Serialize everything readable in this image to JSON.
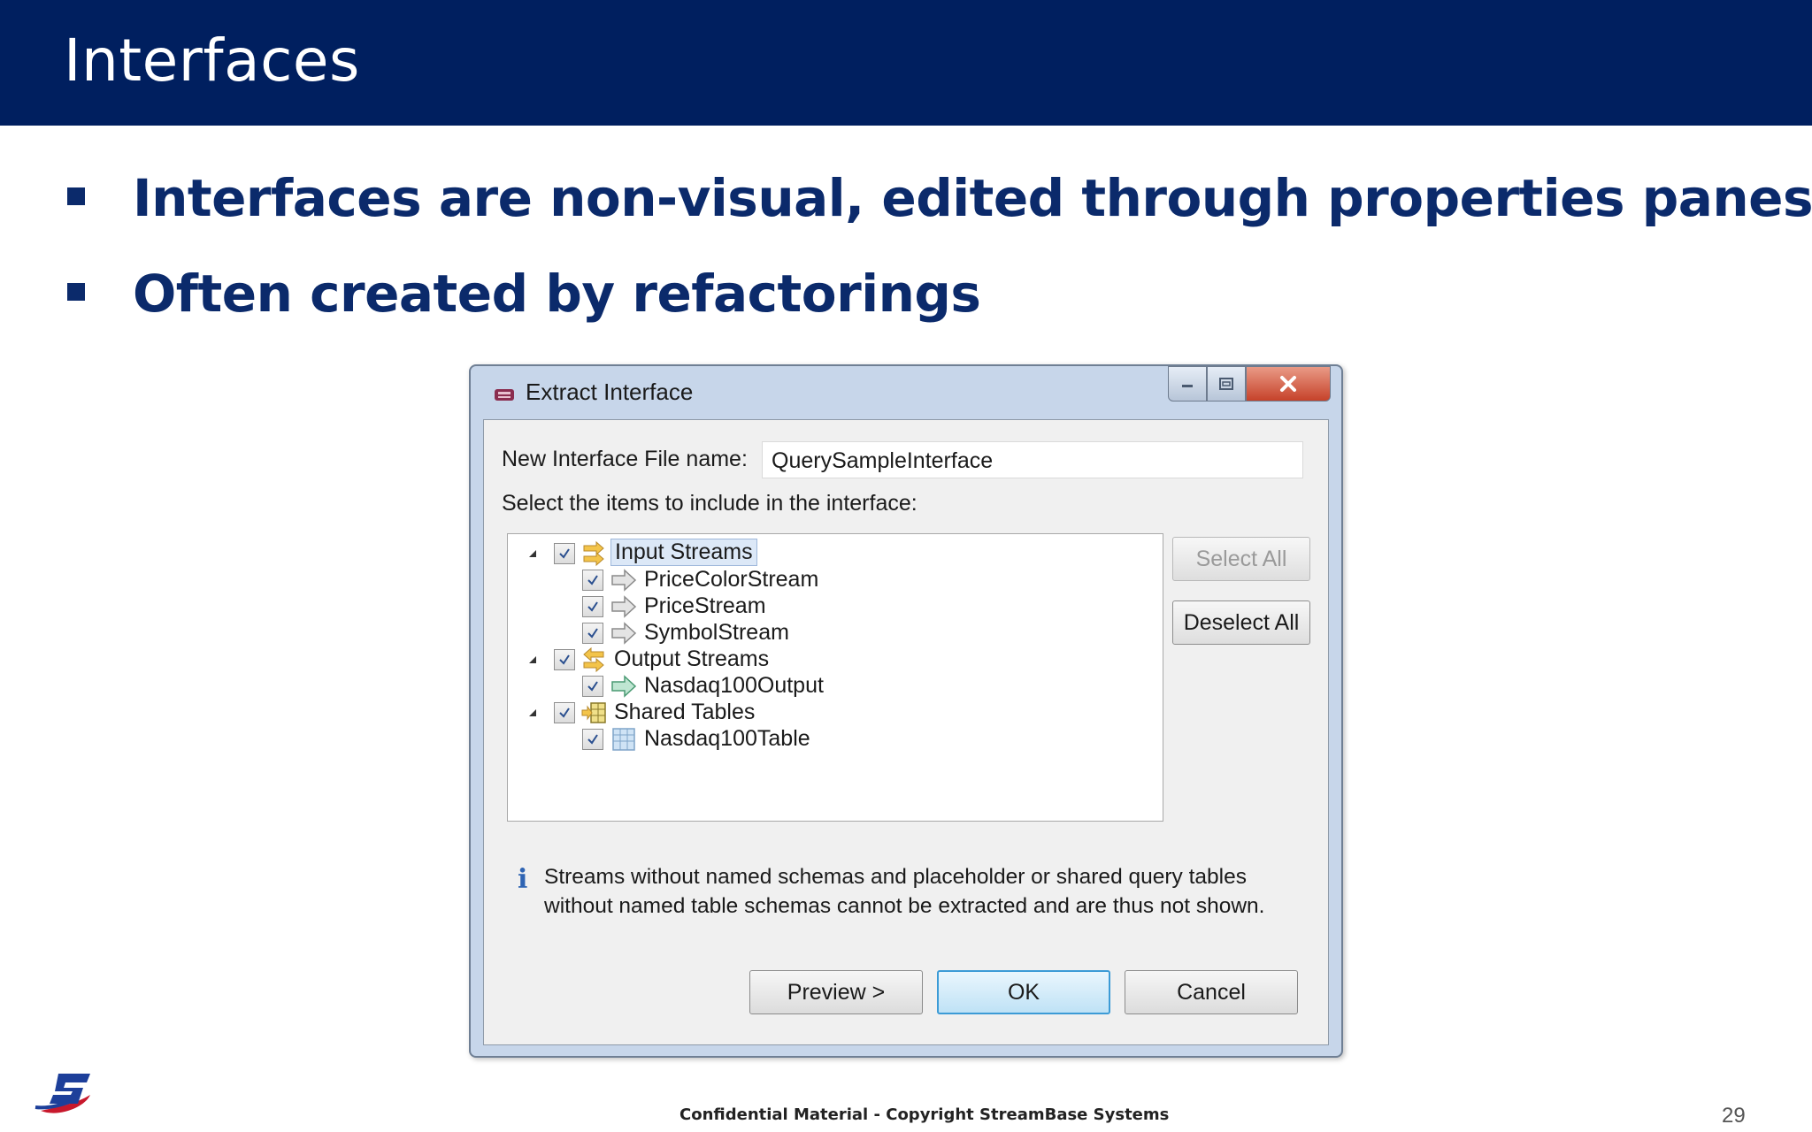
{
  "slide": {
    "title": "Interfaces",
    "bullets": [
      "Interfaces are non-visual, edited through properties panes",
      "Often created by refactorings"
    ],
    "footer": "Confidential Material - Copyright StreamBase Systems",
    "page_number": "29"
  },
  "dialog": {
    "title": "Extract Interface",
    "name_label": "New Interface File name:",
    "name_value": "QuerySampleInterface",
    "select_label": "Select the items to include in the interface:",
    "tree": [
      {
        "label": "Input Streams",
        "checked": true,
        "icon": "input-streams-icon"
      },
      {
        "label": "PriceColorStream",
        "checked": true,
        "icon": "stream-arrow-icon"
      },
      {
        "label": "PriceStream",
        "checked": true,
        "icon": "stream-arrow-icon"
      },
      {
        "label": "SymbolStream",
        "checked": true,
        "icon": "stream-arrow-icon"
      },
      {
        "label": "Output Streams",
        "checked": true,
        "icon": "output-streams-icon"
      },
      {
        "label": "Nasdaq100Output",
        "checked": true,
        "icon": "output-arrow-icon"
      },
      {
        "label": "Shared Tables",
        "checked": true,
        "icon": "shared-tables-icon"
      },
      {
        "label": "Nasdaq100Table",
        "checked": true,
        "icon": "table-icon"
      }
    ],
    "select_all_label": "Select All",
    "deselect_all_label": "Deselect All",
    "info_text": "Streams without named schemas and placeholder or shared query tables without named table schemas cannot be extracted and are thus not shown.",
    "preview_label": "Preview >",
    "ok_label": "OK",
    "cancel_label": "Cancel"
  },
  "colors": {
    "header_bg": "#001f5f",
    "bullet_text": "#0b2a6b",
    "ok_border": "#3c9bd6"
  }
}
